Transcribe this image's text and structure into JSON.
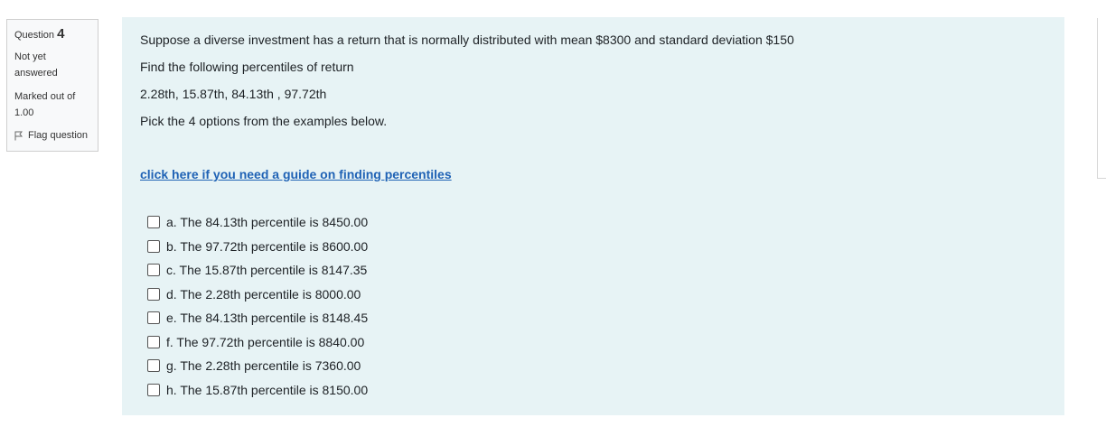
{
  "question_info": {
    "label": "Question",
    "number": "4",
    "state_line1": "Not yet",
    "state_line2": "answered",
    "grade_line1": "Marked out of",
    "grade_line2": "1.00",
    "flag_label": "Flag question",
    "flag_icon": "flag-outline-icon"
  },
  "question": {
    "text_line1": "Suppose a diverse investment has a return that  is normally distributed with mean $8300  and standard deviation $150",
    "text_line2": "Find the following percentiles of return",
    "text_line3": "2.28th, 15.87th, 84.13th , 97.72th",
    "text_line4": "Pick the 4 options from the examples below.",
    "guide_link": "click here if you need a guide on finding percentiles"
  },
  "answers": [
    {
      "label": "a. The 84.13th percentile is 8450.00",
      "checked": false
    },
    {
      "label": "b. The 97.72th percentile is 8600.00",
      "checked": false
    },
    {
      "label": "c. The 15.87th percentile is 8147.35",
      "checked": false
    },
    {
      "label": "d. The 2.28th percentile is 8000.00",
      "checked": false
    },
    {
      "label": "e. The 84.13th percentile is 8148.45",
      "checked": false
    },
    {
      "label": "f. The 97.72th percentile is 8840.00",
      "checked": false
    },
    {
      "label": "g. The 2.28th percentile is 7360.00",
      "checked": false
    },
    {
      "label": "h. The 15.87th percentile is 8150.00",
      "checked": false
    }
  ],
  "colors": {
    "content_bg": "#e7f3f5",
    "link": "#1f62b5",
    "info_bg": "#f8f9fa"
  }
}
